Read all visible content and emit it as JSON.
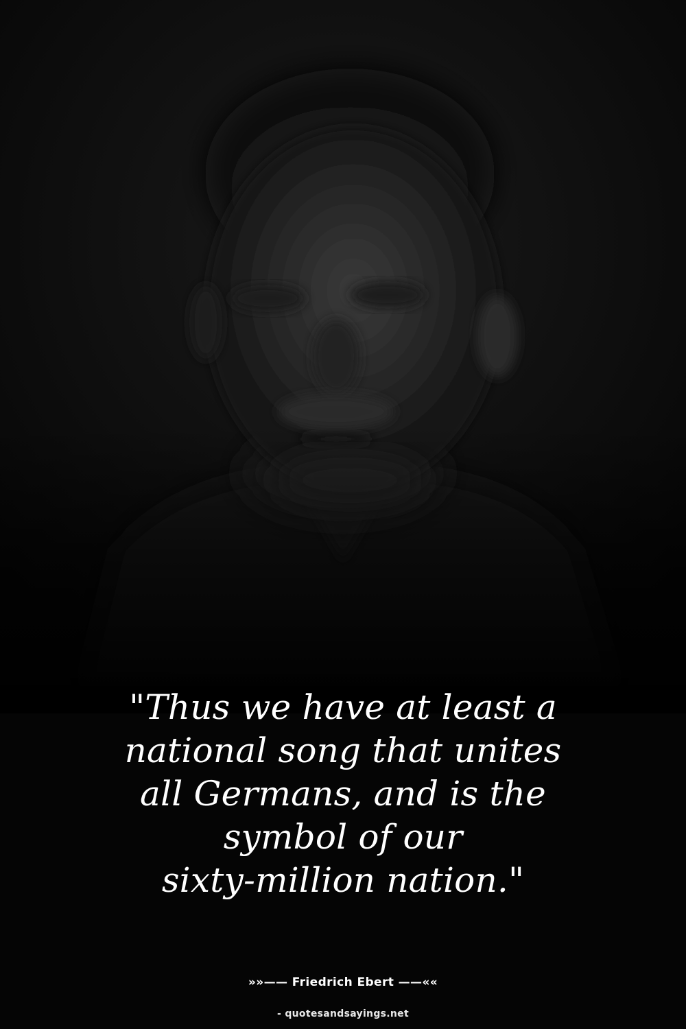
{
  "quote": {
    "line1": "\"Thus we have at least a",
    "line2": "national song that unites",
    "line3": "all Germans, and is the",
    "line4": "symbol of our",
    "line5": "sixty-million nation.\""
  },
  "author": {
    "text": "»»—— Friedrich Ebert ——««"
  },
  "source": {
    "text": "- quotesandsayings.net"
  },
  "colors": {
    "background": "#000000",
    "text": "#ffffff"
  }
}
